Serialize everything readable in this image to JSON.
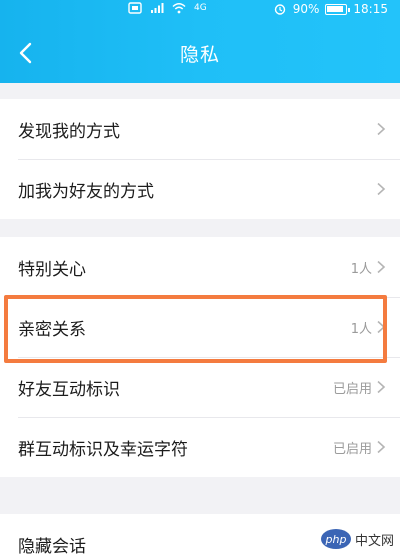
{
  "status_bar": {
    "signal_text": "4G",
    "battery": "90%",
    "time": "18:15",
    "battery_level": 0.9
  },
  "nav": {
    "title": "隐私"
  },
  "groups": [
    {
      "items": [
        {
          "label": "发现我的方式",
          "value": ""
        },
        {
          "label": "加我为好友的方式",
          "value": ""
        }
      ]
    },
    {
      "items": [
        {
          "label": "特别关心",
          "value": "1人"
        },
        {
          "label": "亲密关系",
          "value": "1人"
        },
        {
          "label": "好友互动标识",
          "value": "已启用"
        },
        {
          "label": "群互动标识及幸运字符",
          "value": "已启用"
        }
      ]
    },
    {
      "items": [
        {
          "label": "隐藏会话",
          "value": ""
        }
      ]
    }
  ],
  "watermark": {
    "badge": "php",
    "site": "中文网"
  },
  "colors": {
    "header": "#1fbff7",
    "highlight": "#f47b3f",
    "background": "#f2f2f5"
  }
}
